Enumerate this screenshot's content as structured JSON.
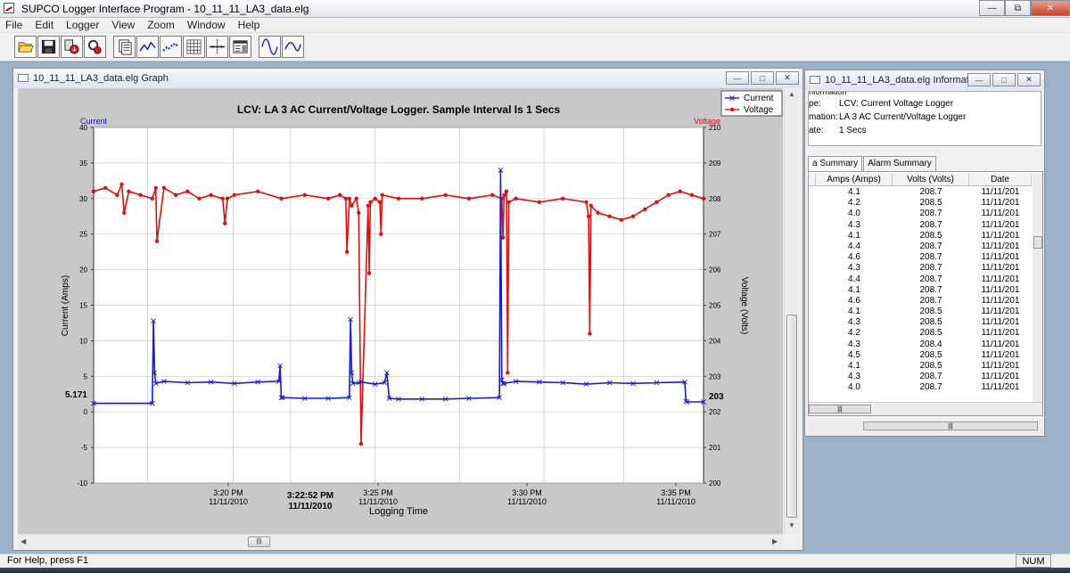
{
  "app": {
    "title": "SUPCO Logger Interface Program - 10_11_11_LA3_data.elg",
    "window_buttons": {
      "minimize": "—",
      "restore": "⧉",
      "close": "✕"
    }
  },
  "menu": [
    "File",
    "Edit",
    "Logger",
    "View",
    "Zoom",
    "Window",
    "Help"
  ],
  "toolbar": {
    "icons": [
      "open-folder-icon",
      "save-disk-icon",
      "download-logger-icon",
      "setup-logger-icon",
      "document-view-icon",
      "line-graph-icon",
      "dotted-graph-icon",
      "grid-icon",
      "cursor-crosshair-icon",
      "info-panel-icon",
      "sine-wave-icon",
      "wave-icon"
    ]
  },
  "graph_window": {
    "title": "10_11_11_LA3_data.elg Graph",
    "buttons": {
      "minimize": "—",
      "restore": "□",
      "close": "✕"
    },
    "scroll_thumb": "|||"
  },
  "chart_data": {
    "type": "line",
    "title": "LCV: LA 3 AC Current/Voltage Logger.  Sample Interval Is 1 Secs",
    "xlabel": "Logging Time",
    "ylabel": "Current (Amps)",
    "y2label": "Voltage (Volts)",
    "left_axis_tag": "Current",
    "right_axis_tag": "Voltage",
    "ylim": [
      -10,
      40
    ],
    "y2lim": [
      200,
      210
    ],
    "yticks": [
      -10,
      -5,
      0,
      5,
      10,
      15,
      20,
      25,
      30,
      35,
      40
    ],
    "y2ticks": [
      200,
      201,
      202,
      203,
      204,
      205,
      206,
      207,
      208,
      209,
      210
    ],
    "cursor_value": "5.171",
    "cursor_time": "3:22:52 PM",
    "cursor_date": "11/11/2010",
    "xticks": [
      {
        "time": "3:20 PM",
        "date": "11/11/2010"
      },
      {
        "time": "3:25 PM",
        "date": "11/11/2010"
      },
      {
        "time": "3:30 PM",
        "date": "11/11/2010"
      },
      {
        "time": "3:35 PM",
        "date": "11/11/2010"
      }
    ],
    "grid": true,
    "legend_position": "top-right",
    "series": [
      {
        "name": "Current",
        "color": "#1a1acc",
        "marker": "x",
        "x_minutes": [
          0,
          2.5,
          2.55,
          2.6,
          2.65,
          3.0,
          4.0,
          5.0,
          6.0,
          7.0,
          7.9,
          7.95,
          8.0,
          8.05,
          9.0,
          10.0,
          10.9,
          10.95,
          11.0,
          11.05,
          11.3,
          11.4,
          12.0,
          12.4,
          12.5,
          12.6,
          13.0,
          14.0,
          15.0,
          16.0,
          17.3,
          17.35,
          17.4,
          17.45,
          17.5,
          18.0,
          19.0,
          20.0,
          21.0,
          22.0,
          23.0,
          24.0,
          25.2,
          25.25,
          25.3,
          26.0
        ],
        "y": [
          1.2,
          1.2,
          12.8,
          5.5,
          4.0,
          4.3,
          4.1,
          4.2,
          4.0,
          4.2,
          4.3,
          6.5,
          2.0,
          2.0,
          1.9,
          1.9,
          2.0,
          13.0,
          5.5,
          4.0,
          4.1,
          4.2,
          3.9,
          4.1,
          5.5,
          1.9,
          1.8,
          1.8,
          1.8,
          1.9,
          2.0,
          34.0,
          4.5,
          4.0,
          4.0,
          4.3,
          4.2,
          4.1,
          3.9,
          4.1,
          4.0,
          4.1,
          4.2,
          1.5,
          1.4,
          1.4
        ]
      },
      {
        "name": "Voltage",
        "color": "#dd1111",
        "marker": "dot",
        "x_minutes": [
          0,
          0.5,
          1.0,
          1.2,
          1.3,
          1.5,
          2.0,
          2.5,
          2.65,
          2.7,
          3.0,
          3.5,
          4.0,
          4.5,
          5.0,
          5.5,
          5.6,
          5.7,
          6.0,
          7.0,
          8.0,
          9.0,
          10.0,
          10.5,
          10.75,
          10.8,
          10.9,
          11.0,
          11.2,
          11.3,
          11.4,
          11.7,
          11.75,
          11.8,
          12.0,
          12.2,
          12.25,
          12.3,
          13.0,
          14.0,
          15.0,
          16.0,
          17.0,
          17.4,
          17.45,
          17.5,
          17.6,
          17.65,
          17.7,
          18.0,
          19.0,
          20.0,
          21.0,
          21.1,
          21.15,
          21.2,
          21.5,
          22.0,
          22.5,
          23.0,
          23.5,
          24.0,
          24.5,
          25.0,
          25.5,
          26.0
        ],
        "y": [
          208.2,
          208.3,
          208.1,
          208.4,
          207.6,
          208.2,
          208.1,
          208.0,
          208.3,
          206.8,
          208.3,
          208.1,
          208.2,
          208.0,
          208.1,
          208.0,
          207.3,
          208.0,
          208.1,
          208.2,
          208.0,
          208.1,
          208.0,
          208.1,
          208.0,
          206.5,
          208.0,
          207.8,
          208.0,
          207.6,
          201.1,
          207.8,
          205.9,
          207.9,
          208.0,
          207.9,
          207.0,
          208.1,
          208.0,
          208.0,
          208.1,
          208.0,
          208.1,
          208.0,
          206.9,
          208.1,
          208.2,
          203.1,
          207.9,
          208.0,
          207.9,
          208.0,
          207.9,
          207.5,
          204.2,
          207.8,
          207.6,
          207.5,
          207.4,
          207.5,
          207.7,
          207.9,
          208.1,
          208.2,
          208.1,
          208.0
        ]
      }
    ]
  },
  "info_window": {
    "title": "10_11_11_LA3_data.elg Information",
    "buttons": {
      "minimize": "—",
      "restore": "□",
      "close": "✕"
    },
    "header_cut": "nformation",
    "fields": [
      {
        "label": "pe:",
        "value": "LCV: Current Voltage Logger"
      },
      {
        "label": "mation:",
        "value": "LA 3 AC Current/Voltage Logger"
      },
      {
        "label": "ate:",
        "value": "1 Secs"
      }
    ],
    "tabs": [
      "a Summary",
      "Alarm Summary"
    ],
    "table": {
      "columns": [
        "Amps (Amps)",
        "Volts (Volts)",
        "Date"
      ],
      "rows": [
        [
          "4.1",
          "208.7",
          "11/11/201"
        ],
        [
          "4.2",
          "208.5",
          "11/11/201"
        ],
        [
          "4.0",
          "208.7",
          "11/11/201"
        ],
        [
          "4.3",
          "208.7",
          "11/11/201"
        ],
        [
          "4.1",
          "208.5",
          "11/11/201"
        ],
        [
          "4.4",
          "208.7",
          "11/11/201"
        ],
        [
          "4.6",
          "208.7",
          "11/11/201"
        ],
        [
          "4.3",
          "208.7",
          "11/11/201"
        ],
        [
          "4.4",
          "208.7",
          "11/11/201"
        ],
        [
          "4.1",
          "208.7",
          "11/11/201"
        ],
        [
          "4.6",
          "208.7",
          "11/11/201"
        ],
        [
          "4.1",
          "208.5",
          "11/11/201"
        ],
        [
          "4.3",
          "208.5",
          "11/11/201"
        ],
        [
          "4.2",
          "208.5",
          "11/11/201"
        ],
        [
          "4.3",
          "208.4",
          "11/11/201"
        ],
        [
          "4.5",
          "208.5",
          "11/11/201"
        ],
        [
          "4.1",
          "208.5",
          "11/11/201"
        ],
        [
          "4.3",
          "208.7",
          "11/11/201"
        ],
        [
          "4.0",
          "208.7",
          "11/11/201"
        ]
      ]
    },
    "scroll_thumb": "|||"
  },
  "status": {
    "help": "For Help, press F1",
    "num": "NUM"
  }
}
